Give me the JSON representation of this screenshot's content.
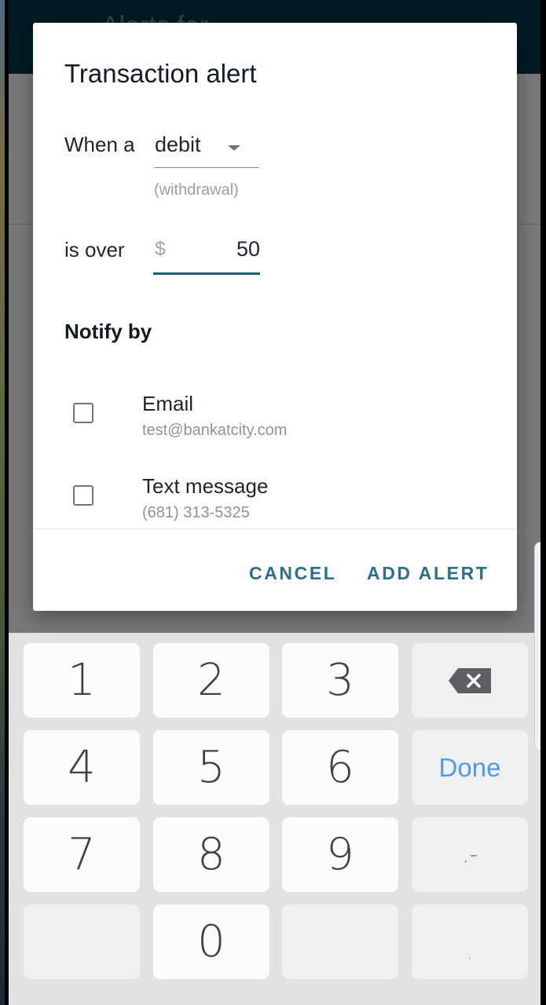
{
  "appbar": {
    "title": "Alerts for"
  },
  "dialog": {
    "title": "Transaction alert",
    "when_label": "When a",
    "transaction_type": {
      "selected": "debit",
      "hint": "(withdrawal)"
    },
    "over_label": "is over",
    "amount": {
      "currency_symbol": "$",
      "value": "50"
    },
    "notify_heading": "Notify by",
    "options": [
      {
        "title": "Email",
        "subtitle": "test@bankatcity.com",
        "checked": false
      },
      {
        "title": "Text message",
        "subtitle": "(681) 313-5325",
        "checked": false
      }
    ],
    "cancel_label": "CANCEL",
    "confirm_label": "ADD ALERT"
  },
  "keyboard": {
    "keys": [
      "1",
      "2",
      "3",
      "4",
      "5",
      "6",
      "7",
      "8",
      "9",
      "0"
    ],
    "done_label": "Done",
    "punct_label": ".-",
    "comma_label": ",",
    "backspace_icon": "backspace-icon",
    "done_color": "#4f9ce8"
  },
  "colors": {
    "appbar": "#03374d",
    "accent": "#2d6f88",
    "focus_underline": "#1b5e78"
  }
}
